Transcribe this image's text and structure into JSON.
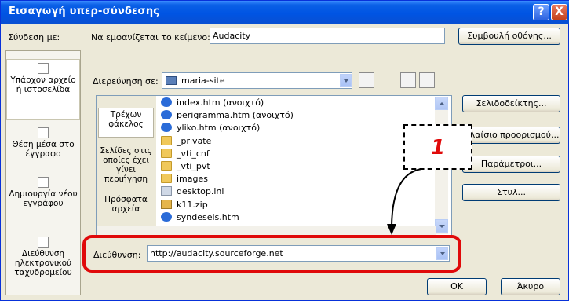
{
  "dialog": {
    "title": "Εισαγωγή υπερ-σύνδεσης",
    "help_label": "?",
    "close_label": "X"
  },
  "link_to_label": "Σύνδεση με:",
  "text_to_display": {
    "label": "Να εμφανίζεται το κείμενο:",
    "value": "Audacity"
  },
  "screen_tip_button": "Συμβουλή οθόνης...",
  "look_in": {
    "label": "Διερεύνηση σε:",
    "value": "maria-site"
  },
  "sidebar": {
    "items": [
      {
        "label": "Υπάρχον αρχείο ή ιστοσελίδα",
        "selected": true
      },
      {
        "label": "Θέση μέσα στο έγγραφο",
        "selected": false
      },
      {
        "label": "Δημιουργία νέου εγγράφου",
        "selected": false
      },
      {
        "label": "Διεύθυνση ηλεκτρονικού ταχυδρομείου",
        "selected": false
      }
    ]
  },
  "categories": [
    {
      "label": "Τρέχων φάκελος",
      "selected": true
    },
    {
      "label": "Σελίδες στις οποίες έχει γίνει περιήγηση",
      "selected": false
    },
    {
      "label": "Πρόσφατα αρχεία",
      "selected": false
    }
  ],
  "files": [
    {
      "name": "index.htm (ανοιχτό)",
      "icon": "ie-page-icon"
    },
    {
      "name": "perigramma.htm (ανοιχτό)",
      "icon": "ie-page-icon"
    },
    {
      "name": "yliko.htm (ανοιχτό)",
      "icon": "ie-page-icon"
    },
    {
      "name": "_private",
      "icon": "folder-icon"
    },
    {
      "name": "_vti_cnf",
      "icon": "folder-icon"
    },
    {
      "name": "_vti_pvt",
      "icon": "folder-icon"
    },
    {
      "name": "images",
      "icon": "folder-icon"
    },
    {
      "name": "desktop.ini",
      "icon": "ini-file-icon"
    },
    {
      "name": "k11.zip",
      "icon": "zip-file-icon"
    },
    {
      "name": "syndeseis.htm",
      "icon": "ie-page-icon"
    }
  ],
  "right_buttons": {
    "bookmark": "Σελιδοδείκτης...",
    "target_frame": "Πλαίσιο προορισμού...",
    "parameters": "Παράμετροι...",
    "style": "Στυλ..."
  },
  "address": {
    "label": "Διεύθυνση:",
    "value": "http://audacity.sourceforge.net"
  },
  "ok_button": "OK",
  "cancel_button": "Άκυρο",
  "annotation": {
    "number": "1",
    "color": "#e00a0a"
  },
  "colors": {
    "titlebar": "#0054e3",
    "dialog_bg": "#ece9d8",
    "highlight": "#e00a0a"
  }
}
